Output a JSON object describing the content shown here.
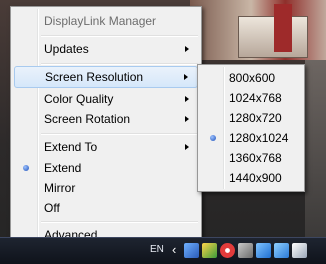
{
  "menu": {
    "title": "DisplayLink Manager",
    "updates": "Updates",
    "screen_resolution": "Screen Resolution",
    "color_quality": "Color Quality",
    "screen_rotation": "Screen Rotation",
    "extend_to": "Extend To",
    "extend": "Extend",
    "mirror": "Mirror",
    "off": "Off",
    "advanced": "Advanced..."
  },
  "resolution_submenu": {
    "options": [
      "800x600",
      "1024x768",
      "1280x720",
      "1280x1024",
      "1360x768",
      "1440x900"
    ],
    "selected": "1280x1024"
  },
  "taskbar": {
    "language": "EN",
    "tray_icons": [
      "displaylink-icon",
      "shield-icon",
      "no-entry-icon",
      "pen-icon",
      "network-icon",
      "display-icon",
      "volume-icon"
    ]
  },
  "colors": {
    "highlight": "#d5e7fa",
    "highlight_border": "#a8caef",
    "menu_bg": "#f0f0f0"
  }
}
